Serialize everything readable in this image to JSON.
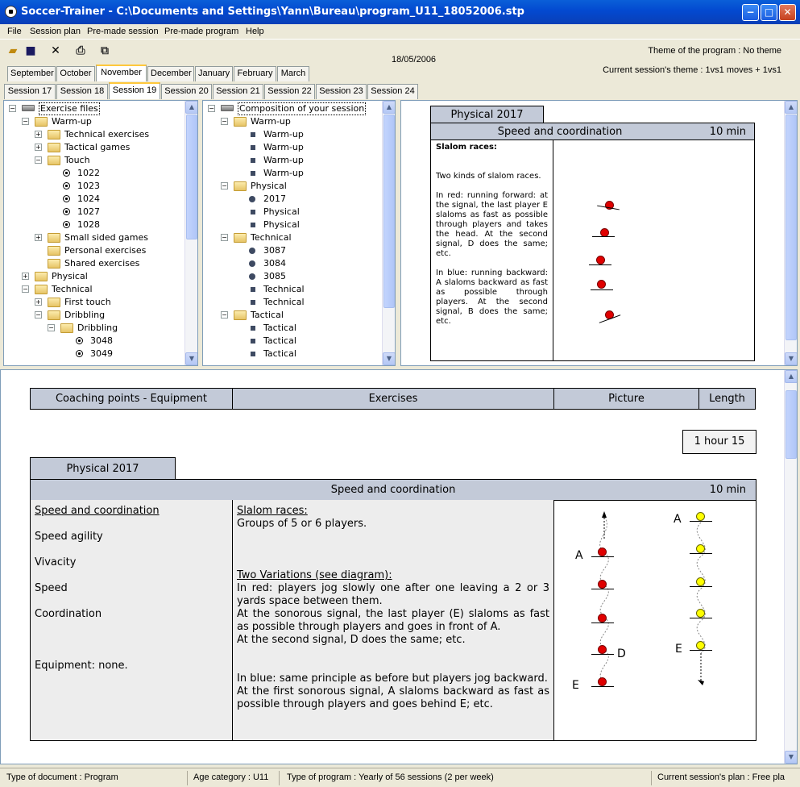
{
  "window": {
    "title": "Soccer-Trainer - C:\\Documents and Settings\\Yann\\Bureau\\program_U11_18052006.stp",
    "min": "−",
    "max": "□",
    "close": "✕"
  },
  "menu": [
    "File",
    "Session plan",
    "Pre-made session",
    "Pre-made program",
    "Help"
  ],
  "toolbar": {
    "icons": [
      "open-folder-icon",
      "save-icon",
      "delete-icon",
      "print-icon",
      "export-icon"
    ],
    "date": "18/05/2006",
    "theme_program": "Theme of the program : No theme",
    "theme_session": "Current session's theme : 1vs1 moves + 1vs1"
  },
  "month_tabs": [
    "September",
    "October",
    "November",
    "December",
    "January",
    "February",
    "March"
  ],
  "selected_month": "November",
  "session_tabs": [
    "Session 17",
    "Session 18",
    "Session 19",
    "Session 20",
    "Session 21",
    "Session 22",
    "Session 23",
    "Session 24"
  ],
  "selected_session": "Session 19",
  "tree1": [
    {
      "label": "Exercise files",
      "level": 0,
      "exp": "−",
      "icon": "library"
    },
    {
      "label": "Warm-up",
      "level": 1,
      "exp": "−",
      "icon": "folder"
    },
    {
      "label": "Technical exercises",
      "level": 2,
      "exp": "+",
      "icon": "folder"
    },
    {
      "label": "Tactical games",
      "level": 2,
      "exp": "+",
      "icon": "folder"
    },
    {
      "label": "Touch",
      "level": 2,
      "exp": "−",
      "icon": "folder"
    },
    {
      "label": "1022",
      "level": 3,
      "icon": "ball"
    },
    {
      "label": "1023",
      "level": 3,
      "icon": "ball"
    },
    {
      "label": "1024",
      "level": 3,
      "icon": "ball"
    },
    {
      "label": "1027",
      "level": 3,
      "icon": "ball"
    },
    {
      "label": "1028",
      "level": 3,
      "icon": "ball"
    },
    {
      "label": "Small sided games",
      "level": 2,
      "exp": "+",
      "icon": "folder"
    },
    {
      "label": "Personal exercises",
      "level": 2,
      "icon": "folder"
    },
    {
      "label": "Shared exercises",
      "level": 2,
      "icon": "folder"
    },
    {
      "label": "Physical",
      "level": 1,
      "exp": "+",
      "icon": "folder"
    },
    {
      "label": "Technical",
      "level": 1,
      "exp": "−",
      "icon": "folder"
    },
    {
      "label": "First touch",
      "level": 2,
      "exp": "+",
      "icon": "folder"
    },
    {
      "label": "Dribbling",
      "level": 2,
      "exp": "−",
      "icon": "folder"
    },
    {
      "label": "Dribbling",
      "level": 3,
      "exp": "−",
      "icon": "folder"
    },
    {
      "label": "3048",
      "level": 4,
      "icon": "ball"
    },
    {
      "label": "3049",
      "level": 4,
      "icon": "ball"
    }
  ],
  "tree2": [
    {
      "label": "Composition of your session",
      "level": 0,
      "exp": "−",
      "icon": "library"
    },
    {
      "label": "Warm-up",
      "level": 1,
      "exp": "−",
      "icon": "folder"
    },
    {
      "label": "Warm-up",
      "level": 2,
      "icon": "square"
    },
    {
      "label": "Warm-up",
      "level": 2,
      "icon": "square"
    },
    {
      "label": "Warm-up",
      "level": 2,
      "icon": "square"
    },
    {
      "label": "Warm-up",
      "level": 2,
      "icon": "square"
    },
    {
      "label": "Physical",
      "level": 1,
      "exp": "−",
      "icon": "folder"
    },
    {
      "label": "2017",
      "level": 2,
      "icon": "dot"
    },
    {
      "label": "Physical",
      "level": 2,
      "icon": "square"
    },
    {
      "label": "Physical",
      "level": 2,
      "icon": "square"
    },
    {
      "label": "Technical",
      "level": 1,
      "exp": "−",
      "icon": "folder"
    },
    {
      "label": "3087",
      "level": 2,
      "icon": "dot"
    },
    {
      "label": "3084",
      "level": 2,
      "icon": "dot"
    },
    {
      "label": "3085",
      "level": 2,
      "icon": "dot"
    },
    {
      "label": "Technical",
      "level": 2,
      "icon": "square"
    },
    {
      "label": "Technical",
      "level": 2,
      "icon": "square"
    },
    {
      "label": "Tactical",
      "level": 1,
      "exp": "−",
      "icon": "folder"
    },
    {
      "label": "Tactical",
      "level": 2,
      "icon": "square"
    },
    {
      "label": "Tactical",
      "level": 2,
      "icon": "square"
    },
    {
      "label": "Tactical",
      "level": 2,
      "icon": "square"
    }
  ],
  "preview": {
    "tab": "Physical 2017",
    "title": "Speed and coordination",
    "duration": "10 min",
    "heading": "Slalom races:",
    "text": [
      "Two kinds of slalom races.",
      "In red: running forward: at the signal, the last player E slaloms as fast as possible through players and takes the head. At the second signal, D does the same; etc.",
      "In blue: running backward: A slaloms backward as fast as possible through players. At the second signal, B does the same; etc."
    ]
  },
  "lower": {
    "columns": [
      "Coaching points - Equipment",
      "Exercises",
      "Picture",
      "Length"
    ],
    "total": "1 hour 15",
    "tab": "Physical 2017",
    "title": "Speed and coordination",
    "duration": "10 min",
    "coaching": [
      "Speed and coordination",
      "Speed agility",
      "Vivacity",
      "Speed",
      "Coordination",
      "Equipment: none."
    ],
    "ex_head1": "Slalom races:",
    "ex_line1": "Groups of 5 or 6 players.",
    "ex_head2": "Two Variations (see diagram):",
    "ex_red": "In red: players jog slowly one after one leaving a 2 or 3 yards space between them.",
    "ex_red2": "At the sonorous signal, the last player (E) slaloms as fast as possible through players and goes in front of A.",
    "ex_red3": "At the second signal, D does the same; etc.",
    "ex_blue": "In blue: same principle as before but players jog backward.",
    "ex_blue2": "At the first sonorous signal, A slaloms backward as fast as possible through players and goes behind E; etc.",
    "diagram_labels": {
      "a_left": "A",
      "d_left": "D",
      "e_left": "E",
      "a_right": "A",
      "e_right": "E"
    }
  },
  "status": {
    "doc": "Type of document : Program",
    "age": "Age category : U11",
    "program": "Type of program : Yearly of 56 sessions (2 per week)",
    "plan": "Current session's plan : Free pla"
  }
}
